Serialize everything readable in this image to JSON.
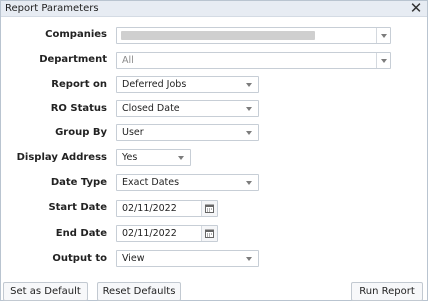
{
  "dialog": {
    "title": "Report Parameters",
    "close_glyph": "✕"
  },
  "form": {
    "companies": {
      "label": "Companies",
      "value": ""
    },
    "department": {
      "label": "Department",
      "value": "All"
    },
    "report_on": {
      "label": "Report on",
      "value": "Deferred Jobs"
    },
    "ro_status": {
      "label": "RO Status",
      "value": "Closed Date"
    },
    "group_by": {
      "label": "Group By",
      "value": "User"
    },
    "display_address": {
      "label": "Display Address",
      "value": "Yes"
    },
    "date_type": {
      "label": "Date Type",
      "value": "Exact Dates"
    },
    "start_date": {
      "label": "Start Date",
      "value": "02/11/2022"
    },
    "end_date": {
      "label": "End Date",
      "value": "02/11/2022"
    },
    "output_to": {
      "label": "Output to",
      "value": "View"
    }
  },
  "buttons": {
    "set_default": "Set as Default",
    "reset_defaults": "Reset Defaults",
    "run_report": "Run Report"
  },
  "icons": {
    "close": "close-icon",
    "dropdown": "chevron-down-icon",
    "calendar": "calendar-icon"
  },
  "colors": {
    "titlebar": "#e7ecf3",
    "border": "#c7ced6",
    "redacted": "#cfcfcf"
  }
}
